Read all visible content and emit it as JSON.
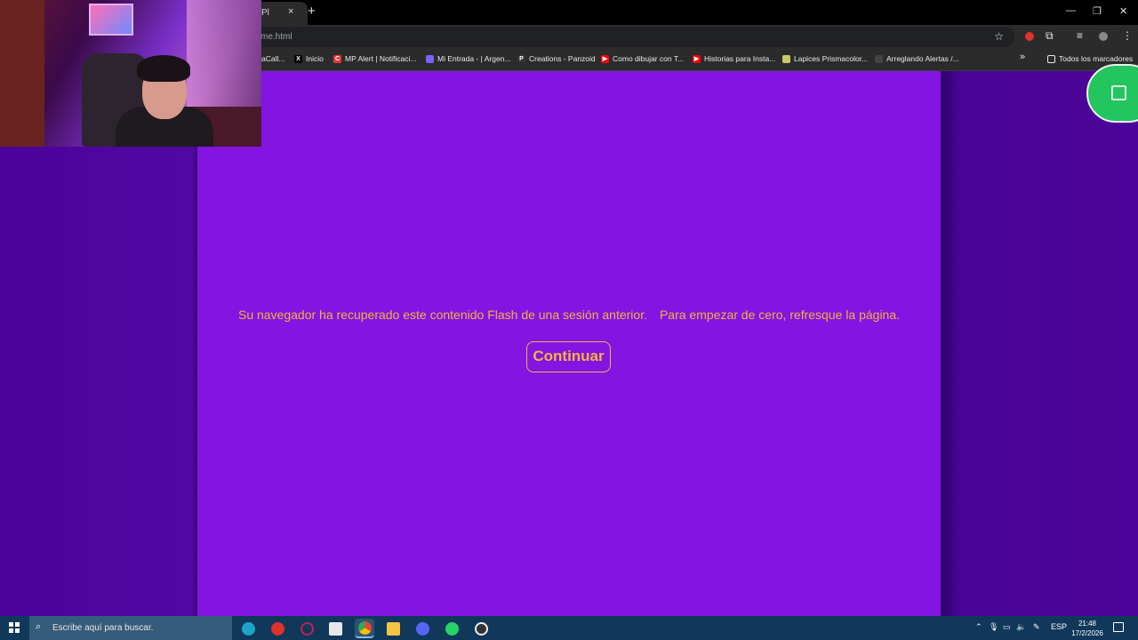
{
  "browser": {
    "tab_title": "Pl",
    "tab_close": "×",
    "new_tab": "+",
    "url": "me.html",
    "window_controls": [
      "—",
      "❐",
      "✕"
    ],
    "bookmarks": [
      {
        "label": "aCall...",
        "icon": "",
        "color": "#2b2b2b"
      },
      {
        "label": "Inicio",
        "icon": "X",
        "color": "#000000"
      },
      {
        "label": "MP Alert | Notificaci...",
        "icon": "C",
        "color": "#e53935"
      },
      {
        "label": "Mi Entrada - | Argen...",
        "icon": "",
        "color": "#7b61ff"
      },
      {
        "label": "Creations - Panzoid",
        "icon": "P",
        "color": "#333333"
      },
      {
        "label": "Como dibujar con T...",
        "icon": "▶",
        "color": "#ff0000"
      },
      {
        "label": "Historias para Insta...",
        "icon": "▶",
        "color": "#ff0000"
      },
      {
        "label": "Lapices Prismacolor...",
        "icon": "",
        "color": "#c9c96a"
      },
      {
        "label": "Arreglando Alertas /...",
        "icon": "",
        "color": "#444444"
      }
    ],
    "bookmarks_overflow": "»",
    "all_bookmarks": "Todos los marcadores",
    "star_icon": "☆",
    "toolbar_icons": [
      "extension-icon",
      "media-icon",
      "profile-icon",
      "menu-icon"
    ]
  },
  "flash": {
    "message_part1": "Su navegador ha recuperado este contenido Flash de una sesión anterior.",
    "message_part2": "Para empezar de cero, refresque la página.",
    "continue_label": "Continuar",
    "stage_color": "#8314e2",
    "accent_color": "#f6b33c"
  },
  "taskbar": {
    "search_placeholder": "Escribe aquí para buscar.",
    "apps": [
      "edge",
      "opera",
      "opera-gx",
      "store",
      "chrome",
      "file-explorer",
      "discord",
      "whatsapp",
      "app"
    ],
    "language": "ESP",
    "time": "21:48",
    "date": "17/2/2026"
  }
}
